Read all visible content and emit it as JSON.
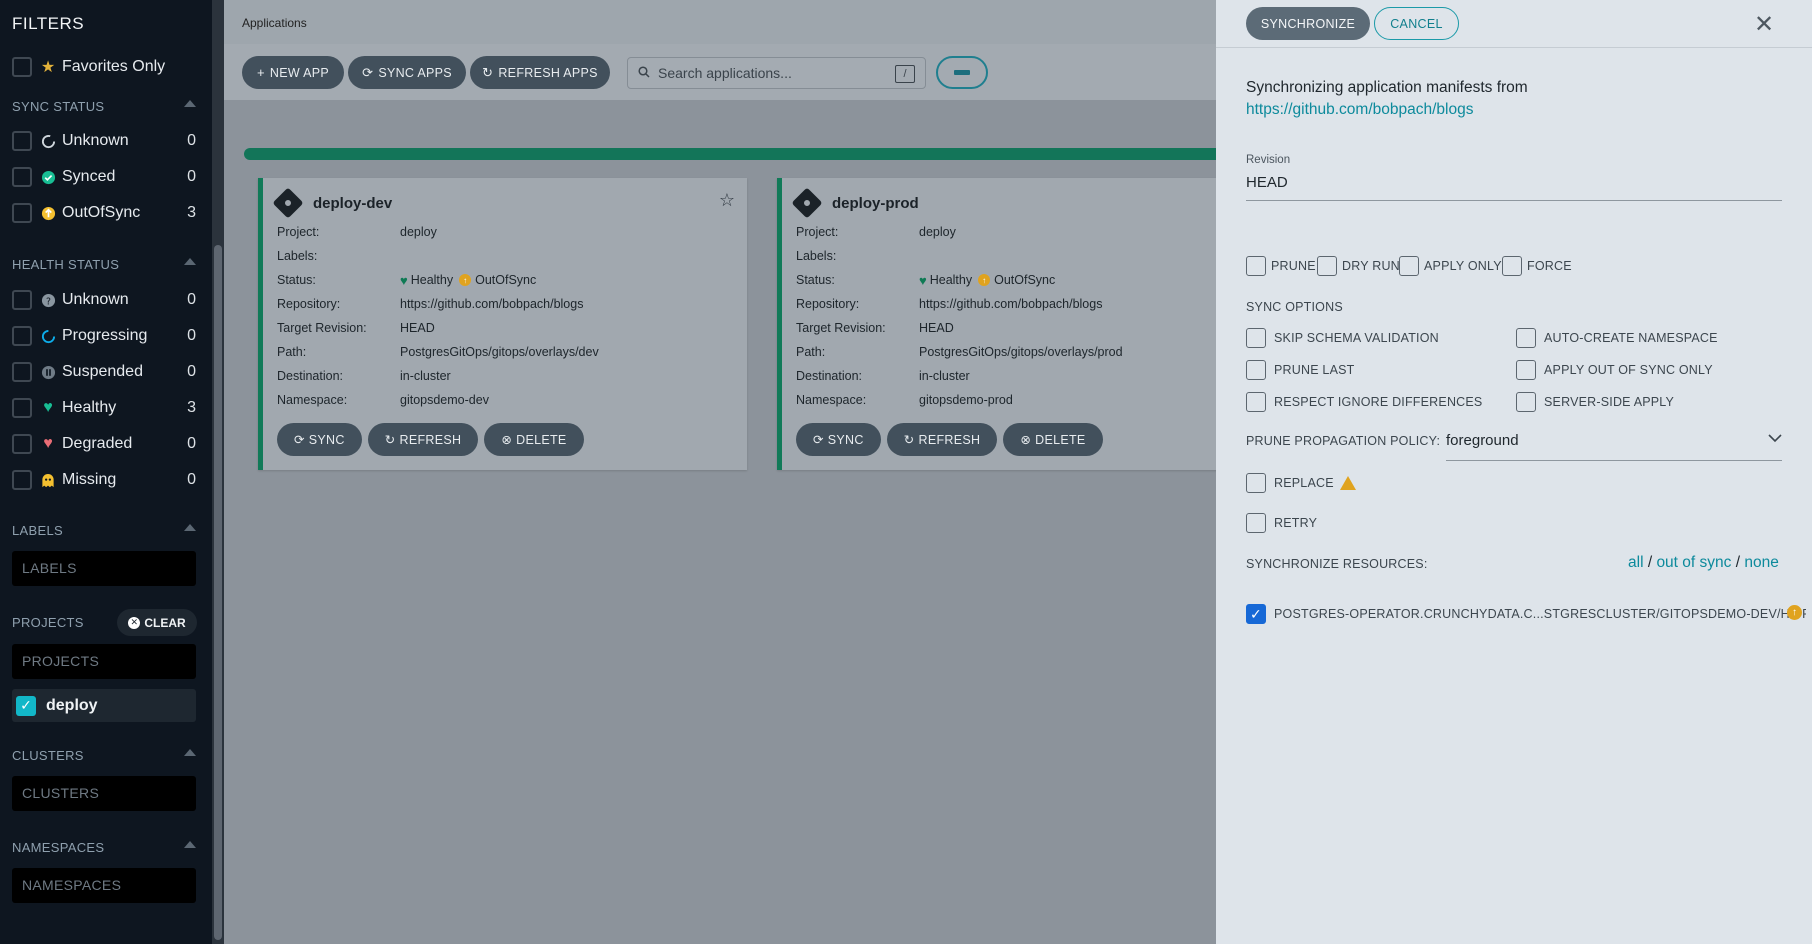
{
  "sidebar": {
    "title": "FILTERS",
    "favorites_label": "Favorites Only",
    "sync_status": {
      "title": "SYNC STATUS",
      "items": [
        {
          "label": "Unknown",
          "count": "0"
        },
        {
          "label": "Synced",
          "count": "0"
        },
        {
          "label": "OutOfSync",
          "count": "3"
        }
      ]
    },
    "health_status": {
      "title": "HEALTH STATUS",
      "items": [
        {
          "label": "Unknown",
          "count": "0"
        },
        {
          "label": "Progressing",
          "count": "0"
        },
        {
          "label": "Suspended",
          "count": "0"
        },
        {
          "label": "Healthy",
          "count": "3"
        },
        {
          "label": "Degraded",
          "count": "0"
        },
        {
          "label": "Missing",
          "count": "0"
        }
      ]
    },
    "labels": {
      "title": "LABELS",
      "placeholder": "LABELS"
    },
    "projects": {
      "title": "PROJECTS",
      "clear_label": "CLEAR",
      "placeholder": "PROJECTS",
      "selected": "deploy"
    },
    "clusters": {
      "title": "CLUSTERS",
      "placeholder": "CLUSTERS"
    },
    "namespaces": {
      "title": "NAMESPACES",
      "placeholder": "NAMESPACES"
    }
  },
  "header": {
    "title": "Applications"
  },
  "toolbar": {
    "new_app": "NEW APP",
    "sync_apps": "SYNC APPS",
    "refresh_apps": "REFRESH APPS",
    "search_placeholder": "Search applications...",
    "search_shortcut": "/"
  },
  "apps": [
    {
      "name": "deploy-dev",
      "project": "deploy",
      "labels": "",
      "health": "Healthy",
      "sync": "OutOfSync",
      "repository": "https://github.com/bobpach/blogs",
      "target_revision": "HEAD",
      "path": "PostgresGitOps/gitops/overlays/dev",
      "destination": "in-cluster",
      "namespace": "gitopsdemo-dev"
    },
    {
      "name": "deploy-prod",
      "project": "deploy",
      "labels": "",
      "health": "Healthy",
      "sync": "OutOfSync",
      "repository": "https://github.com/bobpach/blogs",
      "target_revision": "HEAD",
      "path": "PostgresGitOps/gitops/overlays/prod",
      "destination": "in-cluster",
      "namespace": "gitopsdemo-prod"
    }
  ],
  "card_labels": {
    "project": "Project:",
    "labels": "Labels:",
    "status": "Status:",
    "repository": "Repository:",
    "target_revision": "Target Revision:",
    "path": "Path:",
    "destination": "Destination:",
    "namespace": "Namespace:",
    "sync_btn": "SYNC",
    "refresh_btn": "REFRESH",
    "delete_btn": "DELETE"
  },
  "panel": {
    "synchronize_btn": "SYNCHRONIZE",
    "cancel_btn": "CANCEL",
    "intro": "Synchronizing application manifests from",
    "repo_link": "https://github.com/bobpach/blogs",
    "revision_label": "Revision",
    "revision_value": "HEAD",
    "opts": [
      "PRUNE",
      "DRY RUN",
      "APPLY ONLY",
      "FORCE"
    ],
    "sync_options_title": "SYNC OPTIONS",
    "sync_options": [
      "SKIP SCHEMA VALIDATION",
      "AUTO-CREATE NAMESPACE",
      "PRUNE LAST",
      "APPLY OUT OF SYNC ONLY",
      "RESPECT IGNORE DIFFERENCES",
      "SERVER-SIDE APPLY"
    ],
    "prune_policy_label": "PRUNE PROPAGATION POLICY:",
    "prune_policy_value": "foreground",
    "replace_label": "REPLACE",
    "retry_label": "RETRY",
    "sync_resources_label": "SYNCHRONIZE RESOURCES:",
    "res_all": "all",
    "res_out_of_sync": "out of sync",
    "res_none": "none",
    "resource_left": "POSTGRES-OPERATOR.CRUNCHYDATA.C...",
    "resource_right": "STGRESCLUSTER/GITOPSDEMO-DEV/HIPPO"
  },
  "colors": {
    "accent": "#0d8a9c",
    "healthy": "#0f7a55",
    "out_of_sync": "#e0a31f",
    "sidebar_bg": "#0e1620"
  }
}
